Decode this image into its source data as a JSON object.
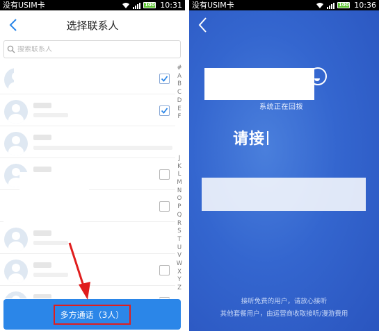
{
  "left": {
    "status_bar": {
      "carrier": "没有USIM卡",
      "time": "10:31",
      "battery": "100"
    },
    "header": {
      "title": "选择联系人"
    },
    "search": {
      "placeholder": "搜索联系人"
    },
    "contacts": [
      {
        "checked": true
      },
      {
        "checked": true
      },
      {
        "checked": false
      },
      {
        "checked": false
      },
      {
        "checked": false
      },
      {
        "checked": false
      },
      {
        "checked": false
      },
      {
        "checked": false
      }
    ],
    "alpha_index": [
      "#",
      "A",
      "B",
      "C",
      "D",
      "E",
      "F",
      "J",
      "K",
      "L",
      "M",
      "N",
      "O",
      "P",
      "Q",
      "R",
      "S",
      "T",
      "U",
      "V",
      "W",
      "X",
      "Y",
      "Z"
    ],
    "multi_call_button": "多方通话（3人）"
  },
  "right": {
    "status_bar": {
      "carrier": "没有USIM卡",
      "time": "10:36",
      "battery": "100"
    },
    "system_text": "系统正在回拨",
    "please_answer": "请接",
    "footer_line1": "接听免费的用户，请放心接听",
    "footer_line2": "其他套餐用户，由运营商收取接听/漫游费用"
  },
  "colors": {
    "accent_blue": "#2b86e8",
    "annotation_red": "#e01d1d",
    "callback_bg": "#3466cf"
  }
}
